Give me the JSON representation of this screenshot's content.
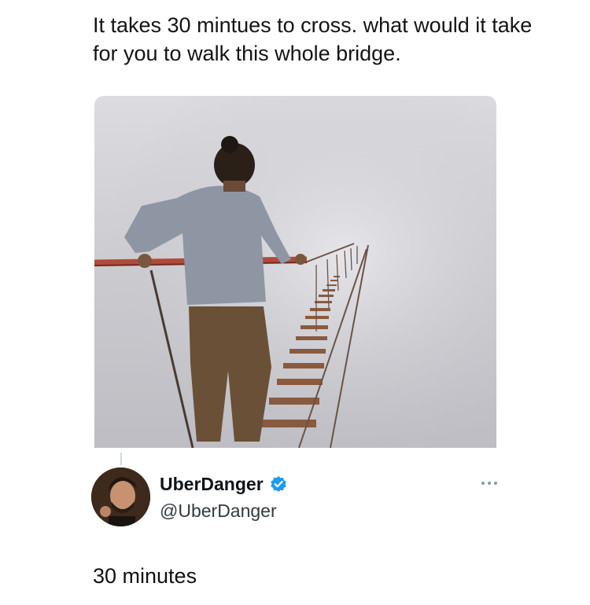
{
  "post": {
    "caption": "It takes 30 mintues to cross. what would it take for you to walk this whole bridge."
  },
  "reply": {
    "author_name": "UberDanger",
    "author_handle": "@UberDanger",
    "text": "30 minutes"
  },
  "icons": {
    "verified": "verified-badge-icon",
    "more": "more-options-icon"
  },
  "colors": {
    "verified_blue": "#1d9bf0",
    "fog": "#cfcfd4",
    "rope": "#b24a3a"
  }
}
